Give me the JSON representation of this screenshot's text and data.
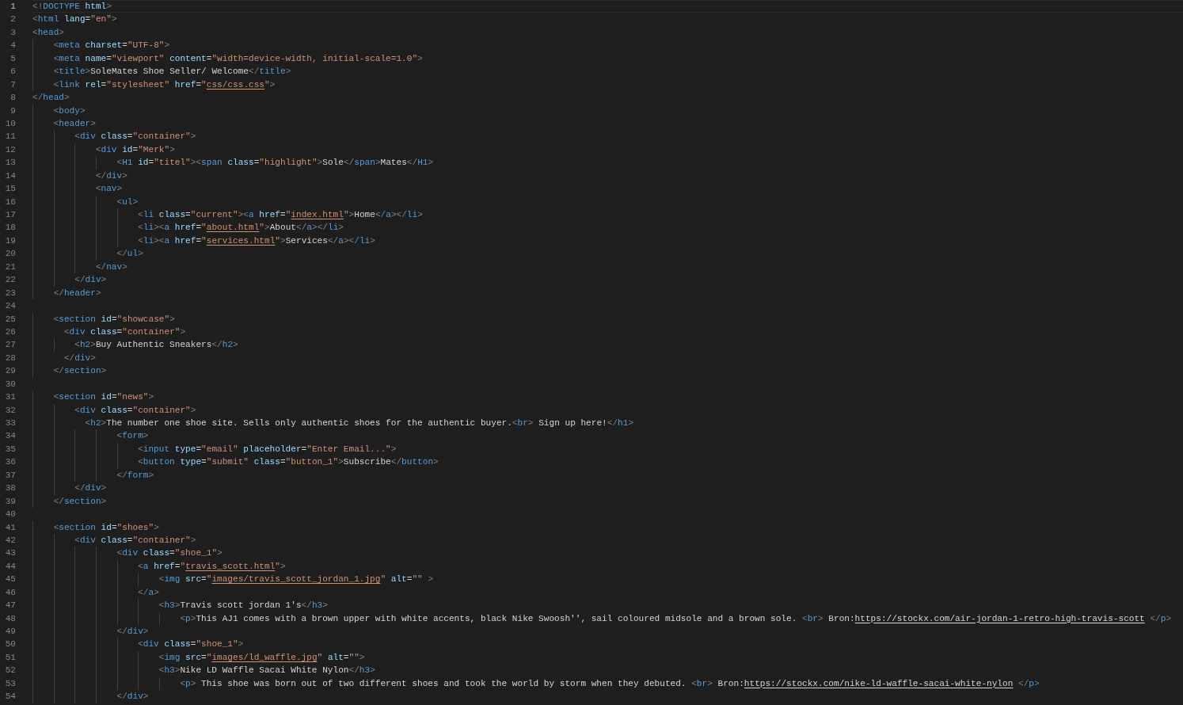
{
  "editor": {
    "lines": [
      {
        "number": "1",
        "current": true,
        "tokens": [
          {
            "kind": "punct",
            "text": "<!"
          },
          {
            "kind": "tag",
            "text": "DOCTYPE"
          },
          {
            "kind": "attr",
            "text": " html"
          },
          {
            "kind": "punct",
            "text": ">"
          }
        ]
      },
      {
        "number": "2",
        "current": false,
        "tokens": [
          {
            "kind": "punct",
            "text": "<"
          },
          {
            "kind": "tag",
            "text": "html"
          },
          {
            "kind": "attr",
            "text": " lang"
          },
          {
            "kind": "text",
            "text": "="
          },
          {
            "kind": "str",
            "text": "\"en\""
          },
          {
            "kind": "punct",
            "text": ">"
          }
        ]
      },
      {
        "number": "3",
        "current": false,
        "tokens": [
          {
            "kind": "punct",
            "text": "<"
          },
          {
            "kind": "tag",
            "text": "head"
          },
          {
            "kind": "punct",
            "text": ">"
          }
        ]
      },
      {
        "number": "4",
        "current": false,
        "tokens": [
          {
            "kind": "punct",
            "text": "    <"
          },
          {
            "kind": "tag",
            "text": "meta"
          },
          {
            "kind": "attr",
            "text": " charset"
          },
          {
            "kind": "text",
            "text": "="
          },
          {
            "kind": "str",
            "text": "\"UTF-8\""
          },
          {
            "kind": "punct",
            "text": ">"
          }
        ]
      },
      {
        "number": "5",
        "current": false,
        "tokens": [
          {
            "kind": "punct",
            "text": "    <"
          },
          {
            "kind": "tag",
            "text": "meta"
          },
          {
            "kind": "attr",
            "text": " name"
          },
          {
            "kind": "text",
            "text": "="
          },
          {
            "kind": "str",
            "text": "\"viewport\""
          },
          {
            "kind": "attr",
            "text": " content"
          },
          {
            "kind": "text",
            "text": "="
          },
          {
            "kind": "str",
            "text": "\"width=device-width, initial-scale=1.0\""
          },
          {
            "kind": "punct",
            "text": ">"
          }
        ]
      },
      {
        "number": "6",
        "current": false,
        "tokens": [
          {
            "kind": "punct",
            "text": "    <"
          },
          {
            "kind": "tag",
            "text": "title"
          },
          {
            "kind": "punct",
            "text": ">"
          },
          {
            "kind": "text",
            "text": "SoleMates Shoe Seller/ Welcome"
          },
          {
            "kind": "punct",
            "text": "</"
          },
          {
            "kind": "tag",
            "text": "title"
          },
          {
            "kind": "punct",
            "text": ">"
          }
        ]
      },
      {
        "number": "7",
        "current": false,
        "tokens": [
          {
            "kind": "punct",
            "text": "    <"
          },
          {
            "kind": "tag",
            "text": "link"
          },
          {
            "kind": "attr",
            "text": " rel"
          },
          {
            "kind": "text",
            "text": "="
          },
          {
            "kind": "str",
            "text": "\"stylesheet\""
          },
          {
            "kind": "attr",
            "text": " href"
          },
          {
            "kind": "text",
            "text": "="
          },
          {
            "kind": "str",
            "text": "\""
          },
          {
            "kind": "link",
            "text": "css/css.css"
          },
          {
            "kind": "str",
            "text": "\""
          },
          {
            "kind": "punct",
            "text": ">"
          }
        ]
      },
      {
        "number": "8",
        "current": false,
        "tokens": [
          {
            "kind": "punct",
            "text": "</"
          },
          {
            "kind": "tag",
            "text": "head"
          },
          {
            "kind": "punct",
            "text": ">"
          }
        ]
      },
      {
        "number": "9",
        "current": false,
        "tokens": [
          {
            "kind": "punct",
            "text": "    <"
          },
          {
            "kind": "tag",
            "text": "body"
          },
          {
            "kind": "punct",
            "text": ">"
          }
        ]
      },
      {
        "number": "10",
        "current": false,
        "tokens": [
          {
            "kind": "punct",
            "text": "    <"
          },
          {
            "kind": "tag",
            "text": "header"
          },
          {
            "kind": "punct",
            "text": ">"
          }
        ]
      },
      {
        "number": "11",
        "current": false,
        "tokens": [
          {
            "kind": "punct",
            "text": "        <"
          },
          {
            "kind": "tag",
            "text": "div"
          },
          {
            "kind": "attr",
            "text": " class"
          },
          {
            "kind": "text",
            "text": "="
          },
          {
            "kind": "str",
            "text": "\"container\""
          },
          {
            "kind": "punct",
            "text": ">"
          }
        ]
      },
      {
        "number": "12",
        "current": false,
        "tokens": [
          {
            "kind": "punct",
            "text": "            <"
          },
          {
            "kind": "tag",
            "text": "div"
          },
          {
            "kind": "attr",
            "text": " id"
          },
          {
            "kind": "text",
            "text": "="
          },
          {
            "kind": "str",
            "text": "\"Merk\""
          },
          {
            "kind": "punct",
            "text": ">"
          }
        ]
      },
      {
        "number": "13",
        "current": false,
        "tokens": [
          {
            "kind": "punct",
            "text": "                <"
          },
          {
            "kind": "tag",
            "text": "H1"
          },
          {
            "kind": "attr",
            "text": " id"
          },
          {
            "kind": "text",
            "text": "="
          },
          {
            "kind": "str",
            "text": "\"titel\""
          },
          {
            "kind": "punct",
            "text": "><"
          },
          {
            "kind": "tag",
            "text": "span"
          },
          {
            "kind": "attr",
            "text": " class"
          },
          {
            "kind": "text",
            "text": "="
          },
          {
            "kind": "str",
            "text": "\"highlight\""
          },
          {
            "kind": "punct",
            "text": ">"
          },
          {
            "kind": "text",
            "text": "Sole"
          },
          {
            "kind": "punct",
            "text": "</"
          },
          {
            "kind": "tag",
            "text": "span"
          },
          {
            "kind": "punct",
            "text": ">"
          },
          {
            "kind": "text",
            "text": "Mates"
          },
          {
            "kind": "punct",
            "text": "</"
          },
          {
            "kind": "tag",
            "text": "H1"
          },
          {
            "kind": "punct",
            "text": ">"
          }
        ]
      },
      {
        "number": "14",
        "current": false,
        "tokens": [
          {
            "kind": "punct",
            "text": "            </"
          },
          {
            "kind": "tag",
            "text": "div"
          },
          {
            "kind": "punct",
            "text": ">"
          }
        ]
      },
      {
        "number": "15",
        "current": false,
        "tokens": [
          {
            "kind": "punct",
            "text": "            <"
          },
          {
            "kind": "tag",
            "text": "nav"
          },
          {
            "kind": "punct",
            "text": ">"
          }
        ]
      },
      {
        "number": "16",
        "current": false,
        "tokens": [
          {
            "kind": "punct",
            "text": "                <"
          },
          {
            "kind": "tag",
            "text": "ul"
          },
          {
            "kind": "punct",
            "text": ">"
          }
        ]
      },
      {
        "number": "17",
        "current": false,
        "tokens": [
          {
            "kind": "punct",
            "text": "                    <"
          },
          {
            "kind": "tag",
            "text": "li"
          },
          {
            "kind": "attr",
            "text": " class"
          },
          {
            "kind": "text",
            "text": "="
          },
          {
            "kind": "str",
            "text": "\"current\""
          },
          {
            "kind": "punct",
            "text": "><"
          },
          {
            "kind": "tag",
            "text": "a"
          },
          {
            "kind": "attr",
            "text": " href"
          },
          {
            "kind": "text",
            "text": "="
          },
          {
            "kind": "str",
            "text": "\""
          },
          {
            "kind": "link",
            "text": "index.html"
          },
          {
            "kind": "str",
            "text": "\""
          },
          {
            "kind": "punct",
            "text": ">"
          },
          {
            "kind": "text",
            "text": "Home"
          },
          {
            "kind": "punct",
            "text": "</"
          },
          {
            "kind": "tag",
            "text": "a"
          },
          {
            "kind": "punct",
            "text": "></"
          },
          {
            "kind": "tag",
            "text": "li"
          },
          {
            "kind": "punct",
            "text": ">"
          }
        ]
      },
      {
        "number": "18",
        "current": false,
        "tokens": [
          {
            "kind": "punct",
            "text": "                    <"
          },
          {
            "kind": "tag",
            "text": "li"
          },
          {
            "kind": "punct",
            "text": "><"
          },
          {
            "kind": "tag",
            "text": "a"
          },
          {
            "kind": "attr",
            "text": " href"
          },
          {
            "kind": "text",
            "text": "="
          },
          {
            "kind": "str",
            "text": "\""
          },
          {
            "kind": "link",
            "text": "about.html"
          },
          {
            "kind": "str",
            "text": "\""
          },
          {
            "kind": "punct",
            "text": ">"
          },
          {
            "kind": "text",
            "text": "About"
          },
          {
            "kind": "punct",
            "text": "</"
          },
          {
            "kind": "tag",
            "text": "a"
          },
          {
            "kind": "punct",
            "text": "></"
          },
          {
            "kind": "tag",
            "text": "li"
          },
          {
            "kind": "punct",
            "text": ">"
          }
        ]
      },
      {
        "number": "19",
        "current": false,
        "tokens": [
          {
            "kind": "punct",
            "text": "                    <"
          },
          {
            "kind": "tag",
            "text": "li"
          },
          {
            "kind": "punct",
            "text": "><"
          },
          {
            "kind": "tag",
            "text": "a"
          },
          {
            "kind": "attr",
            "text": " href"
          },
          {
            "kind": "text",
            "text": "="
          },
          {
            "kind": "str",
            "text": "\""
          },
          {
            "kind": "link",
            "text": "services.html"
          },
          {
            "kind": "str",
            "text": "\""
          },
          {
            "kind": "punct",
            "text": ">"
          },
          {
            "kind": "text",
            "text": "Services"
          },
          {
            "kind": "punct",
            "text": "</"
          },
          {
            "kind": "tag",
            "text": "a"
          },
          {
            "kind": "punct",
            "text": "></"
          },
          {
            "kind": "tag",
            "text": "li"
          },
          {
            "kind": "punct",
            "text": ">"
          }
        ]
      },
      {
        "number": "20",
        "current": false,
        "tokens": [
          {
            "kind": "punct",
            "text": "                </"
          },
          {
            "kind": "tag",
            "text": "ul"
          },
          {
            "kind": "punct",
            "text": ">"
          }
        ]
      },
      {
        "number": "21",
        "current": false,
        "tokens": [
          {
            "kind": "punct",
            "text": "            </"
          },
          {
            "kind": "tag",
            "text": "nav"
          },
          {
            "kind": "punct",
            "text": ">"
          }
        ]
      },
      {
        "number": "22",
        "current": false,
        "tokens": [
          {
            "kind": "punct",
            "text": "        </"
          },
          {
            "kind": "tag",
            "text": "div"
          },
          {
            "kind": "punct",
            "text": ">"
          }
        ]
      },
      {
        "number": "23",
        "current": false,
        "tokens": [
          {
            "kind": "punct",
            "text": "    </"
          },
          {
            "kind": "tag",
            "text": "header"
          },
          {
            "kind": "punct",
            "text": ">"
          }
        ]
      },
      {
        "number": "24",
        "current": false
      },
      {
        "number": "25",
        "current": false,
        "tokens": [
          {
            "kind": "punct",
            "text": "    <"
          },
          {
            "kind": "tag",
            "text": "section"
          },
          {
            "kind": "attr",
            "text": " id"
          },
          {
            "kind": "text",
            "text": "="
          },
          {
            "kind": "str",
            "text": "\"showcase\""
          },
          {
            "kind": "punct",
            "text": ">"
          }
        ]
      },
      {
        "number": "26",
        "current": false,
        "tokens": [
          {
            "kind": "punct",
            "text": "      <"
          },
          {
            "kind": "tag",
            "text": "div"
          },
          {
            "kind": "attr",
            "text": " class"
          },
          {
            "kind": "text",
            "text": "="
          },
          {
            "kind": "str",
            "text": "\"container\""
          },
          {
            "kind": "punct",
            "text": ">"
          }
        ]
      },
      {
        "number": "27",
        "current": false,
        "tokens": [
          {
            "kind": "punct",
            "text": "        <"
          },
          {
            "kind": "tag",
            "text": "h2"
          },
          {
            "kind": "punct",
            "text": ">"
          },
          {
            "kind": "text",
            "text": "Buy Authentic Sneakers"
          },
          {
            "kind": "punct",
            "text": "</"
          },
          {
            "kind": "tag",
            "text": "h2"
          },
          {
            "kind": "punct",
            "text": ">"
          }
        ]
      },
      {
        "number": "28",
        "current": false,
        "tokens": [
          {
            "kind": "punct",
            "text": "      </"
          },
          {
            "kind": "tag",
            "text": "div"
          },
          {
            "kind": "punct",
            "text": ">"
          }
        ]
      },
      {
        "number": "29",
        "current": false,
        "tokens": [
          {
            "kind": "punct",
            "text": "    </"
          },
          {
            "kind": "tag",
            "text": "section"
          },
          {
            "kind": "punct",
            "text": ">"
          }
        ]
      },
      {
        "number": "30",
        "current": false
      },
      {
        "number": "31",
        "current": false,
        "tokens": [
          {
            "kind": "punct",
            "text": "    <"
          },
          {
            "kind": "tag",
            "text": "section"
          },
          {
            "kind": "attr",
            "text": " id"
          },
          {
            "kind": "text",
            "text": "="
          },
          {
            "kind": "str",
            "text": "\"news\""
          },
          {
            "kind": "punct",
            "text": ">"
          }
        ]
      },
      {
        "number": "32",
        "current": false,
        "tokens": [
          {
            "kind": "punct",
            "text": "        <"
          },
          {
            "kind": "tag",
            "text": "div"
          },
          {
            "kind": "attr",
            "text": " class"
          },
          {
            "kind": "text",
            "text": "="
          },
          {
            "kind": "str",
            "text": "\"container\""
          },
          {
            "kind": "punct",
            "text": ">"
          }
        ]
      },
      {
        "number": "33",
        "current": false,
        "tokens": [
          {
            "kind": "punct",
            "text": "          <"
          },
          {
            "kind": "tag",
            "text": "h2"
          },
          {
            "kind": "punct",
            "text": ">"
          },
          {
            "kind": "text",
            "text": "The number one shoe site. Sells only authentic shoes for the authentic buyer."
          },
          {
            "kind": "punct",
            "text": "<"
          },
          {
            "kind": "tag",
            "text": "br"
          },
          {
            "kind": "punct",
            "text": ">"
          },
          {
            "kind": "text",
            "text": " Sign up here!"
          },
          {
            "kind": "punct",
            "text": "</"
          },
          {
            "kind": "tag",
            "text": "h1"
          },
          {
            "kind": "punct",
            "text": ">"
          }
        ]
      },
      {
        "number": "34",
        "current": false,
        "tokens": [
          {
            "kind": "punct",
            "text": "                <"
          },
          {
            "kind": "tag",
            "text": "form"
          },
          {
            "kind": "punct",
            "text": ">"
          }
        ]
      },
      {
        "number": "35",
        "current": false,
        "tokens": [
          {
            "kind": "punct",
            "text": "                    <"
          },
          {
            "kind": "tag",
            "text": "input"
          },
          {
            "kind": "attr",
            "text": " type"
          },
          {
            "kind": "text",
            "text": "="
          },
          {
            "kind": "str",
            "text": "\"email\""
          },
          {
            "kind": "attr",
            "text": " placeholder"
          },
          {
            "kind": "text",
            "text": "="
          },
          {
            "kind": "str",
            "text": "\"Enter Email...\""
          },
          {
            "kind": "punct",
            "text": ">"
          }
        ]
      },
      {
        "number": "36",
        "current": false,
        "tokens": [
          {
            "kind": "punct",
            "text": "                    <"
          },
          {
            "kind": "tag",
            "text": "button"
          },
          {
            "kind": "attr",
            "text": " type"
          },
          {
            "kind": "text",
            "text": "="
          },
          {
            "kind": "str",
            "text": "\"submit\""
          },
          {
            "kind": "attr",
            "text": " class"
          },
          {
            "kind": "text",
            "text": "="
          },
          {
            "kind": "str",
            "text": "\"button_1\""
          },
          {
            "kind": "punct",
            "text": ">"
          },
          {
            "kind": "text",
            "text": "Subscribe"
          },
          {
            "kind": "punct",
            "text": "</"
          },
          {
            "kind": "tag",
            "text": "button"
          },
          {
            "kind": "punct",
            "text": ">"
          }
        ]
      },
      {
        "number": "37",
        "current": false,
        "tokens": [
          {
            "kind": "punct",
            "text": "                </"
          },
          {
            "kind": "tag",
            "text": "form"
          },
          {
            "kind": "punct",
            "text": ">"
          }
        ]
      },
      {
        "number": "38",
        "current": false,
        "tokens": [
          {
            "kind": "punct",
            "text": "        </"
          },
          {
            "kind": "tag",
            "text": "div"
          },
          {
            "kind": "punct",
            "text": ">"
          }
        ]
      },
      {
        "number": "39",
        "current": false,
        "tokens": [
          {
            "kind": "punct",
            "text": "    </"
          },
          {
            "kind": "tag",
            "text": "section"
          },
          {
            "kind": "punct",
            "text": ">"
          }
        ]
      },
      {
        "number": "40",
        "current": false
      },
      {
        "number": "41",
        "current": false,
        "tokens": [
          {
            "kind": "punct",
            "text": "    <"
          },
          {
            "kind": "tag",
            "text": "section"
          },
          {
            "kind": "attr",
            "text": " id"
          },
          {
            "kind": "text",
            "text": "="
          },
          {
            "kind": "str",
            "text": "\"shoes\""
          },
          {
            "kind": "punct",
            "text": ">"
          }
        ]
      },
      {
        "number": "42",
        "current": false,
        "tokens": [
          {
            "kind": "punct",
            "text": "        <"
          },
          {
            "kind": "tag",
            "text": "div"
          },
          {
            "kind": "attr",
            "text": " class"
          },
          {
            "kind": "text",
            "text": "="
          },
          {
            "kind": "str",
            "text": "\"container\""
          },
          {
            "kind": "punct",
            "text": ">"
          }
        ]
      },
      {
        "number": "43",
        "current": false,
        "tokens": [
          {
            "kind": "punct",
            "text": "                <"
          },
          {
            "kind": "tag",
            "text": "div"
          },
          {
            "kind": "attr",
            "text": " class"
          },
          {
            "kind": "text",
            "text": "="
          },
          {
            "kind": "str",
            "text": "\"shoe_1\""
          },
          {
            "kind": "punct",
            "text": ">"
          }
        ]
      },
      {
        "number": "44",
        "current": false,
        "tokens": [
          {
            "kind": "punct",
            "text": "                    <"
          },
          {
            "kind": "tag",
            "text": "a"
          },
          {
            "kind": "attr",
            "text": " href"
          },
          {
            "kind": "text",
            "text": "="
          },
          {
            "kind": "str",
            "text": "\""
          },
          {
            "kind": "link",
            "text": "travis_scott.html"
          },
          {
            "kind": "str",
            "text": "\""
          },
          {
            "kind": "punct",
            "text": ">"
          }
        ]
      },
      {
        "number": "45",
        "current": false,
        "tokens": [
          {
            "kind": "punct",
            "text": "                        <"
          },
          {
            "kind": "tag",
            "text": "img"
          },
          {
            "kind": "attr",
            "text": " src"
          },
          {
            "kind": "text",
            "text": "="
          },
          {
            "kind": "str",
            "text": "\""
          },
          {
            "kind": "link",
            "text": "images/travis_scott_jordan_1.jpg"
          },
          {
            "kind": "str",
            "text": "\""
          },
          {
            "kind": "attr",
            "text": " alt"
          },
          {
            "kind": "text",
            "text": "="
          },
          {
            "kind": "str",
            "text": "\"\""
          },
          {
            "kind": "punct",
            "text": " >"
          }
        ]
      },
      {
        "number": "46",
        "current": false,
        "tokens": [
          {
            "kind": "punct",
            "text": "                    </"
          },
          {
            "kind": "tag",
            "text": "a"
          },
          {
            "kind": "punct",
            "text": ">"
          }
        ]
      },
      {
        "number": "47",
        "current": false,
        "tokens": [
          {
            "kind": "punct",
            "text": "                        <"
          },
          {
            "kind": "tag",
            "text": "h3"
          },
          {
            "kind": "punct",
            "text": ">"
          },
          {
            "kind": "text",
            "text": "Travis scott jordan 1's"
          },
          {
            "kind": "punct",
            "text": "</"
          },
          {
            "kind": "tag",
            "text": "h3"
          },
          {
            "kind": "punct",
            "text": ">"
          }
        ]
      },
      {
        "number": "48",
        "current": false,
        "tokens": [
          {
            "kind": "punct",
            "text": "                            <"
          },
          {
            "kind": "tag",
            "text": "p"
          },
          {
            "kind": "punct",
            "text": ">"
          },
          {
            "kind": "text",
            "text": "This AJ1 comes with a brown upper with white accents, black Nike Swoosh'', sail coloured midsole and a brown sole. "
          },
          {
            "kind": "punct",
            "text": "<"
          },
          {
            "kind": "tag",
            "text": "br"
          },
          {
            "kind": "punct",
            "text": ">"
          },
          {
            "kind": "text",
            "text": " Bron:"
          },
          {
            "kind": "url",
            "text": "https://stockx.com/air-jordan-1-retro-high-travis-scott"
          },
          {
            "kind": "punct",
            "text": " </"
          },
          {
            "kind": "tag",
            "text": "p"
          },
          {
            "kind": "punct",
            "text": ">"
          }
        ]
      },
      {
        "number": "49",
        "current": false,
        "tokens": [
          {
            "kind": "punct",
            "text": "                </"
          },
          {
            "kind": "tag",
            "text": "div"
          },
          {
            "kind": "punct",
            "text": ">"
          }
        ]
      },
      {
        "number": "50",
        "current": false,
        "tokens": [
          {
            "kind": "punct",
            "text": "                    <"
          },
          {
            "kind": "tag",
            "text": "div"
          },
          {
            "kind": "attr",
            "text": " class"
          },
          {
            "kind": "text",
            "text": "="
          },
          {
            "kind": "str",
            "text": "\"shoe_1\""
          },
          {
            "kind": "punct",
            "text": ">"
          }
        ]
      },
      {
        "number": "51",
        "current": false,
        "tokens": [
          {
            "kind": "punct",
            "text": "                        <"
          },
          {
            "kind": "tag",
            "text": "img"
          },
          {
            "kind": "attr",
            "text": " src"
          },
          {
            "kind": "text",
            "text": "="
          },
          {
            "kind": "str",
            "text": "\""
          },
          {
            "kind": "link",
            "text": "images/ld_waffle.jpg"
          },
          {
            "kind": "str",
            "text": "\""
          },
          {
            "kind": "attr",
            "text": " alt"
          },
          {
            "kind": "text",
            "text": "="
          },
          {
            "kind": "str",
            "text": "\"\""
          },
          {
            "kind": "punct",
            "text": ">"
          }
        ]
      },
      {
        "number": "52",
        "current": false,
        "tokens": [
          {
            "kind": "punct",
            "text": "                        <"
          },
          {
            "kind": "tag",
            "text": "h3"
          },
          {
            "kind": "punct",
            "text": ">"
          },
          {
            "kind": "text",
            "text": "Nike LD Waffle Sacai White Nylon"
          },
          {
            "kind": "punct",
            "text": "</"
          },
          {
            "kind": "tag",
            "text": "h3"
          },
          {
            "kind": "punct",
            "text": ">"
          }
        ]
      },
      {
        "number": "53",
        "current": false,
        "tokens": [
          {
            "kind": "punct",
            "text": "                            <"
          },
          {
            "kind": "tag",
            "text": "p"
          },
          {
            "kind": "punct",
            "text": ">"
          },
          {
            "kind": "text",
            "text": " This shoe was born out of two different shoes and took the world by storm when they debuted. "
          },
          {
            "kind": "punct",
            "text": "<"
          },
          {
            "kind": "tag",
            "text": "br"
          },
          {
            "kind": "punct",
            "text": ">"
          },
          {
            "kind": "text",
            "text": " Bron:"
          },
          {
            "kind": "url",
            "text": "https://stockx.com/nike-ld-waffle-sacai-white-nylon"
          },
          {
            "kind": "punct",
            "text": " </"
          },
          {
            "kind": "tag",
            "text": "p"
          },
          {
            "kind": "punct",
            "text": ">"
          }
        ]
      },
      {
        "number": "54",
        "current": false,
        "tokens": [
          {
            "kind": "punct",
            "text": "                </"
          },
          {
            "kind": "tag",
            "text": "div"
          },
          {
            "kind": "punct",
            "text": ">"
          }
        ]
      }
    ]
  }
}
